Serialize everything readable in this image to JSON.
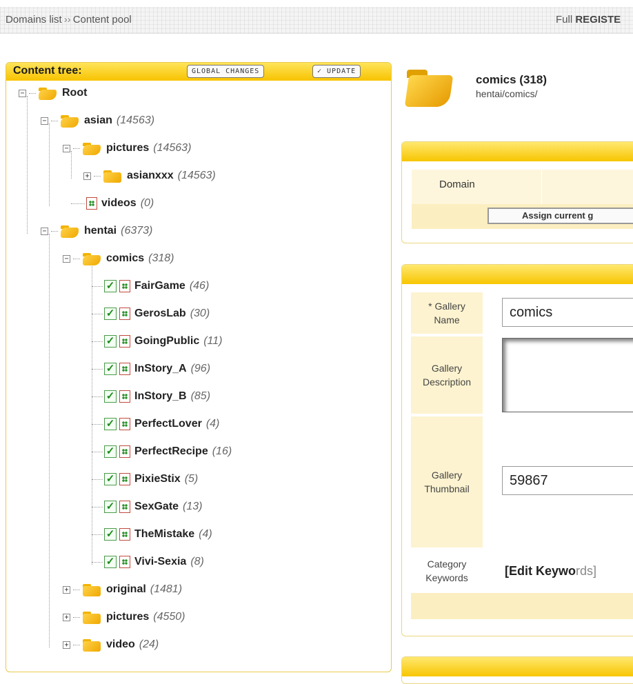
{
  "topbar": {
    "breadcrumb": [
      "Domains list",
      "Content pool"
    ],
    "separator": "››",
    "right_text_prefix": "Full ",
    "right_text_bold": "REGISTE"
  },
  "tree_panel": {
    "title": "Content tree:",
    "global_changes_label": "GLOBAL CHANGES",
    "update_label": "✓ UPDATE"
  },
  "tree": {
    "root": "Root",
    "asian": {
      "name": "asian",
      "count": "(14563)"
    },
    "asian_pictures": {
      "name": "pictures",
      "count": "(14563)"
    },
    "asianxxx": {
      "name": "asianxxx",
      "count": "(14563)"
    },
    "asian_videos": {
      "name": "videos",
      "count": "(0)"
    },
    "hentai": {
      "name": "hentai",
      "count": "(6373)"
    },
    "comics": {
      "name": "comics",
      "count": "(318)"
    },
    "comics_items": [
      {
        "name": "FairGame",
        "count": "(46)"
      },
      {
        "name": "GerosLab",
        "count": "(30)"
      },
      {
        "name": "GoingPublic",
        "count": "(11)"
      },
      {
        "name": "InStory_A",
        "count": "(96)"
      },
      {
        "name": "InStory_B",
        "count": "(85)"
      },
      {
        "name": "PerfectLover",
        "count": "(4)"
      },
      {
        "name": "PerfectRecipe",
        "count": "(16)"
      },
      {
        "name": "PixieStix",
        "count": "(5)"
      },
      {
        "name": "SexGate",
        "count": "(13)"
      },
      {
        "name": "TheMistake",
        "count": "(4)"
      },
      {
        "name": "Vivi-Sexia",
        "count": "(8)"
      }
    ],
    "original": {
      "name": "original",
      "count": "(1481)"
    },
    "hentai_pictures": {
      "name": "pictures",
      "count": "(4550)"
    },
    "video": {
      "name": "video",
      "count": "(24)"
    }
  },
  "gallery": {
    "title": "comics (318)",
    "path": "hentai/comics/"
  },
  "domain_panel": {
    "domain_label": "Domain",
    "assign_label": "Assign current g"
  },
  "form": {
    "name_label_1": "* Gallery",
    "name_label_2": "Name",
    "name_value": "comics",
    "desc_label_1": "Gallery",
    "desc_label_2": "Description",
    "thumb_label_1": "Gallery",
    "thumb_label_2": "Thumbnail",
    "thumb_value": "59867",
    "kw_label_1": "Category",
    "kw_label_2": "Keywords",
    "kw_link": "[Edit Keywo",
    "kw_link_rest": "rds]"
  },
  "icons": [
    "folder-icon",
    "page-icon",
    "checkbox-checked",
    "expand-plus",
    "collapse-minus"
  ]
}
